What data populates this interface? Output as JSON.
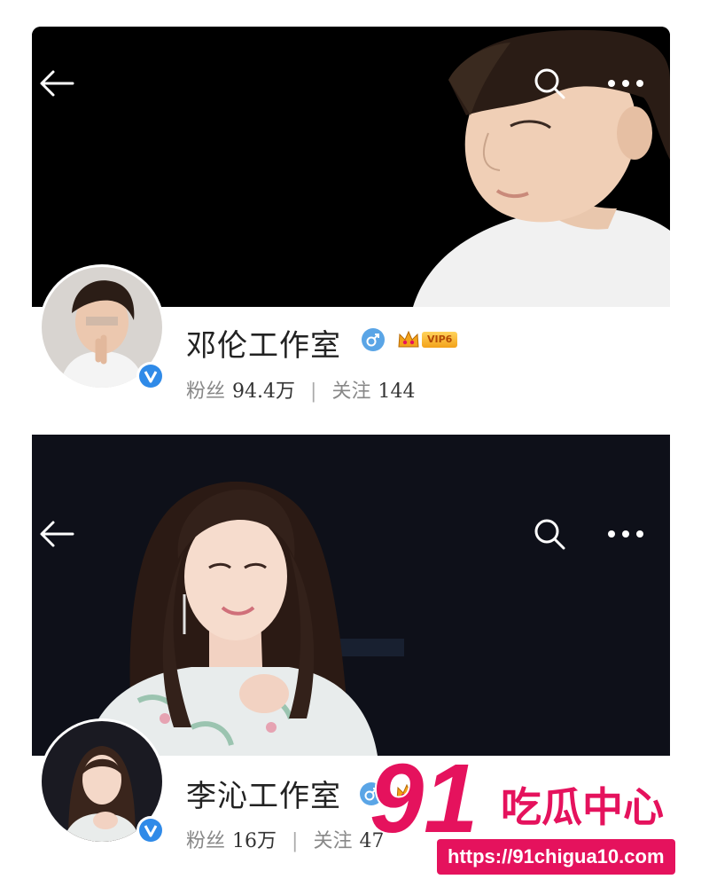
{
  "profiles": [
    {
      "name": "邓伦工作室",
      "vip_level": "VIP6",
      "fans_label": "粉丝",
      "fans_count": "94.4万",
      "following_label": "关注",
      "following_count": "144"
    },
    {
      "name": "李沁工作室",
      "fans_label": "粉丝",
      "fans_count": "16万",
      "following_label": "关注",
      "following_count": "47"
    }
  ],
  "icons": {
    "back": "back-arrow-icon",
    "search": "search-icon",
    "more": "more-dots-icon",
    "verified": "verified-v-icon",
    "gender": "male-gender-icon",
    "vip": "crown-icon"
  },
  "colors": {
    "verified_blue": "#2f8ae8",
    "gender_blue": "#5aa5e6",
    "vip_gold": "#f3a21a",
    "watermark_pink": "#e5125d"
  },
  "watermark": {
    "number": "91",
    "brand": "吃瓜中心",
    "url": "https://91chigua10.com"
  }
}
